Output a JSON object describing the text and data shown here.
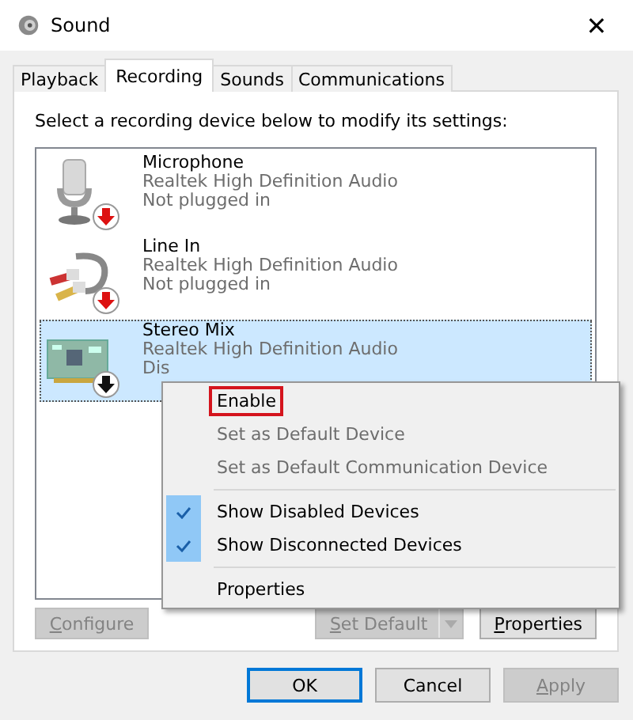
{
  "window": {
    "title": "Sound",
    "close": "✕"
  },
  "tabs": [
    {
      "label": "Playback",
      "selected": false
    },
    {
      "label": "Recording",
      "selected": true
    },
    {
      "label": "Sounds",
      "selected": false
    },
    {
      "label": "Communications",
      "selected": false
    }
  ],
  "instruction": "Select a recording device below to modify its settings:",
  "devices": [
    {
      "name": "Microphone",
      "driver": "Realtek High Definition Audio",
      "status": "Not plugged in",
      "kind": "microphone",
      "badge": {
        "kind": "unplugged"
      },
      "selected": false
    },
    {
      "name": "Line In",
      "driver": "Realtek High Definition Audio",
      "status": "Not plugged in",
      "kind": "line-in",
      "badge": {
        "kind": "unplugged"
      },
      "selected": false
    },
    {
      "name": "Stereo Mix",
      "driver": "Realtek High Definition Audio",
      "status": "Dis",
      "kind": "sound-card",
      "badge": {
        "kind": "disabled"
      },
      "selected": true
    }
  ],
  "context_menu": [
    {
      "kind": "item",
      "label": "Enable",
      "disabled": false,
      "checked": false,
      "highlighted": true
    },
    {
      "kind": "item",
      "label": "Set as Default Device",
      "disabled": true,
      "checked": false,
      "highlighted": false
    },
    {
      "kind": "item",
      "label": "Set as Default Communication Device",
      "disabled": true,
      "checked": false,
      "highlighted": false
    },
    {
      "kind": "separator"
    },
    {
      "kind": "item",
      "label": "Show Disabled Devices",
      "disabled": false,
      "checked": true,
      "highlighted": false
    },
    {
      "kind": "item",
      "label": "Show Disconnected Devices",
      "disabled": false,
      "checked": true,
      "highlighted": false
    },
    {
      "kind": "separator"
    },
    {
      "kind": "item",
      "label": "Properties",
      "disabled": false,
      "checked": false,
      "highlighted": false
    }
  ],
  "panel_buttons": [
    {
      "label": "Configure",
      "underline_first": true,
      "disabled": true,
      "split": false
    },
    {
      "label": "Set Default",
      "underline_first": true,
      "disabled": true,
      "split": true
    },
    {
      "label": "Properties",
      "underline_first": true,
      "disabled": false,
      "split": false
    }
  ],
  "dialog_buttons": [
    {
      "label": "OK",
      "underline_first": false,
      "disabled": false,
      "default": true
    },
    {
      "label": "Cancel",
      "underline_first": false,
      "disabled": false,
      "default": false
    },
    {
      "label": "Apply",
      "underline_first": true,
      "disabled": true,
      "default": false
    }
  ]
}
